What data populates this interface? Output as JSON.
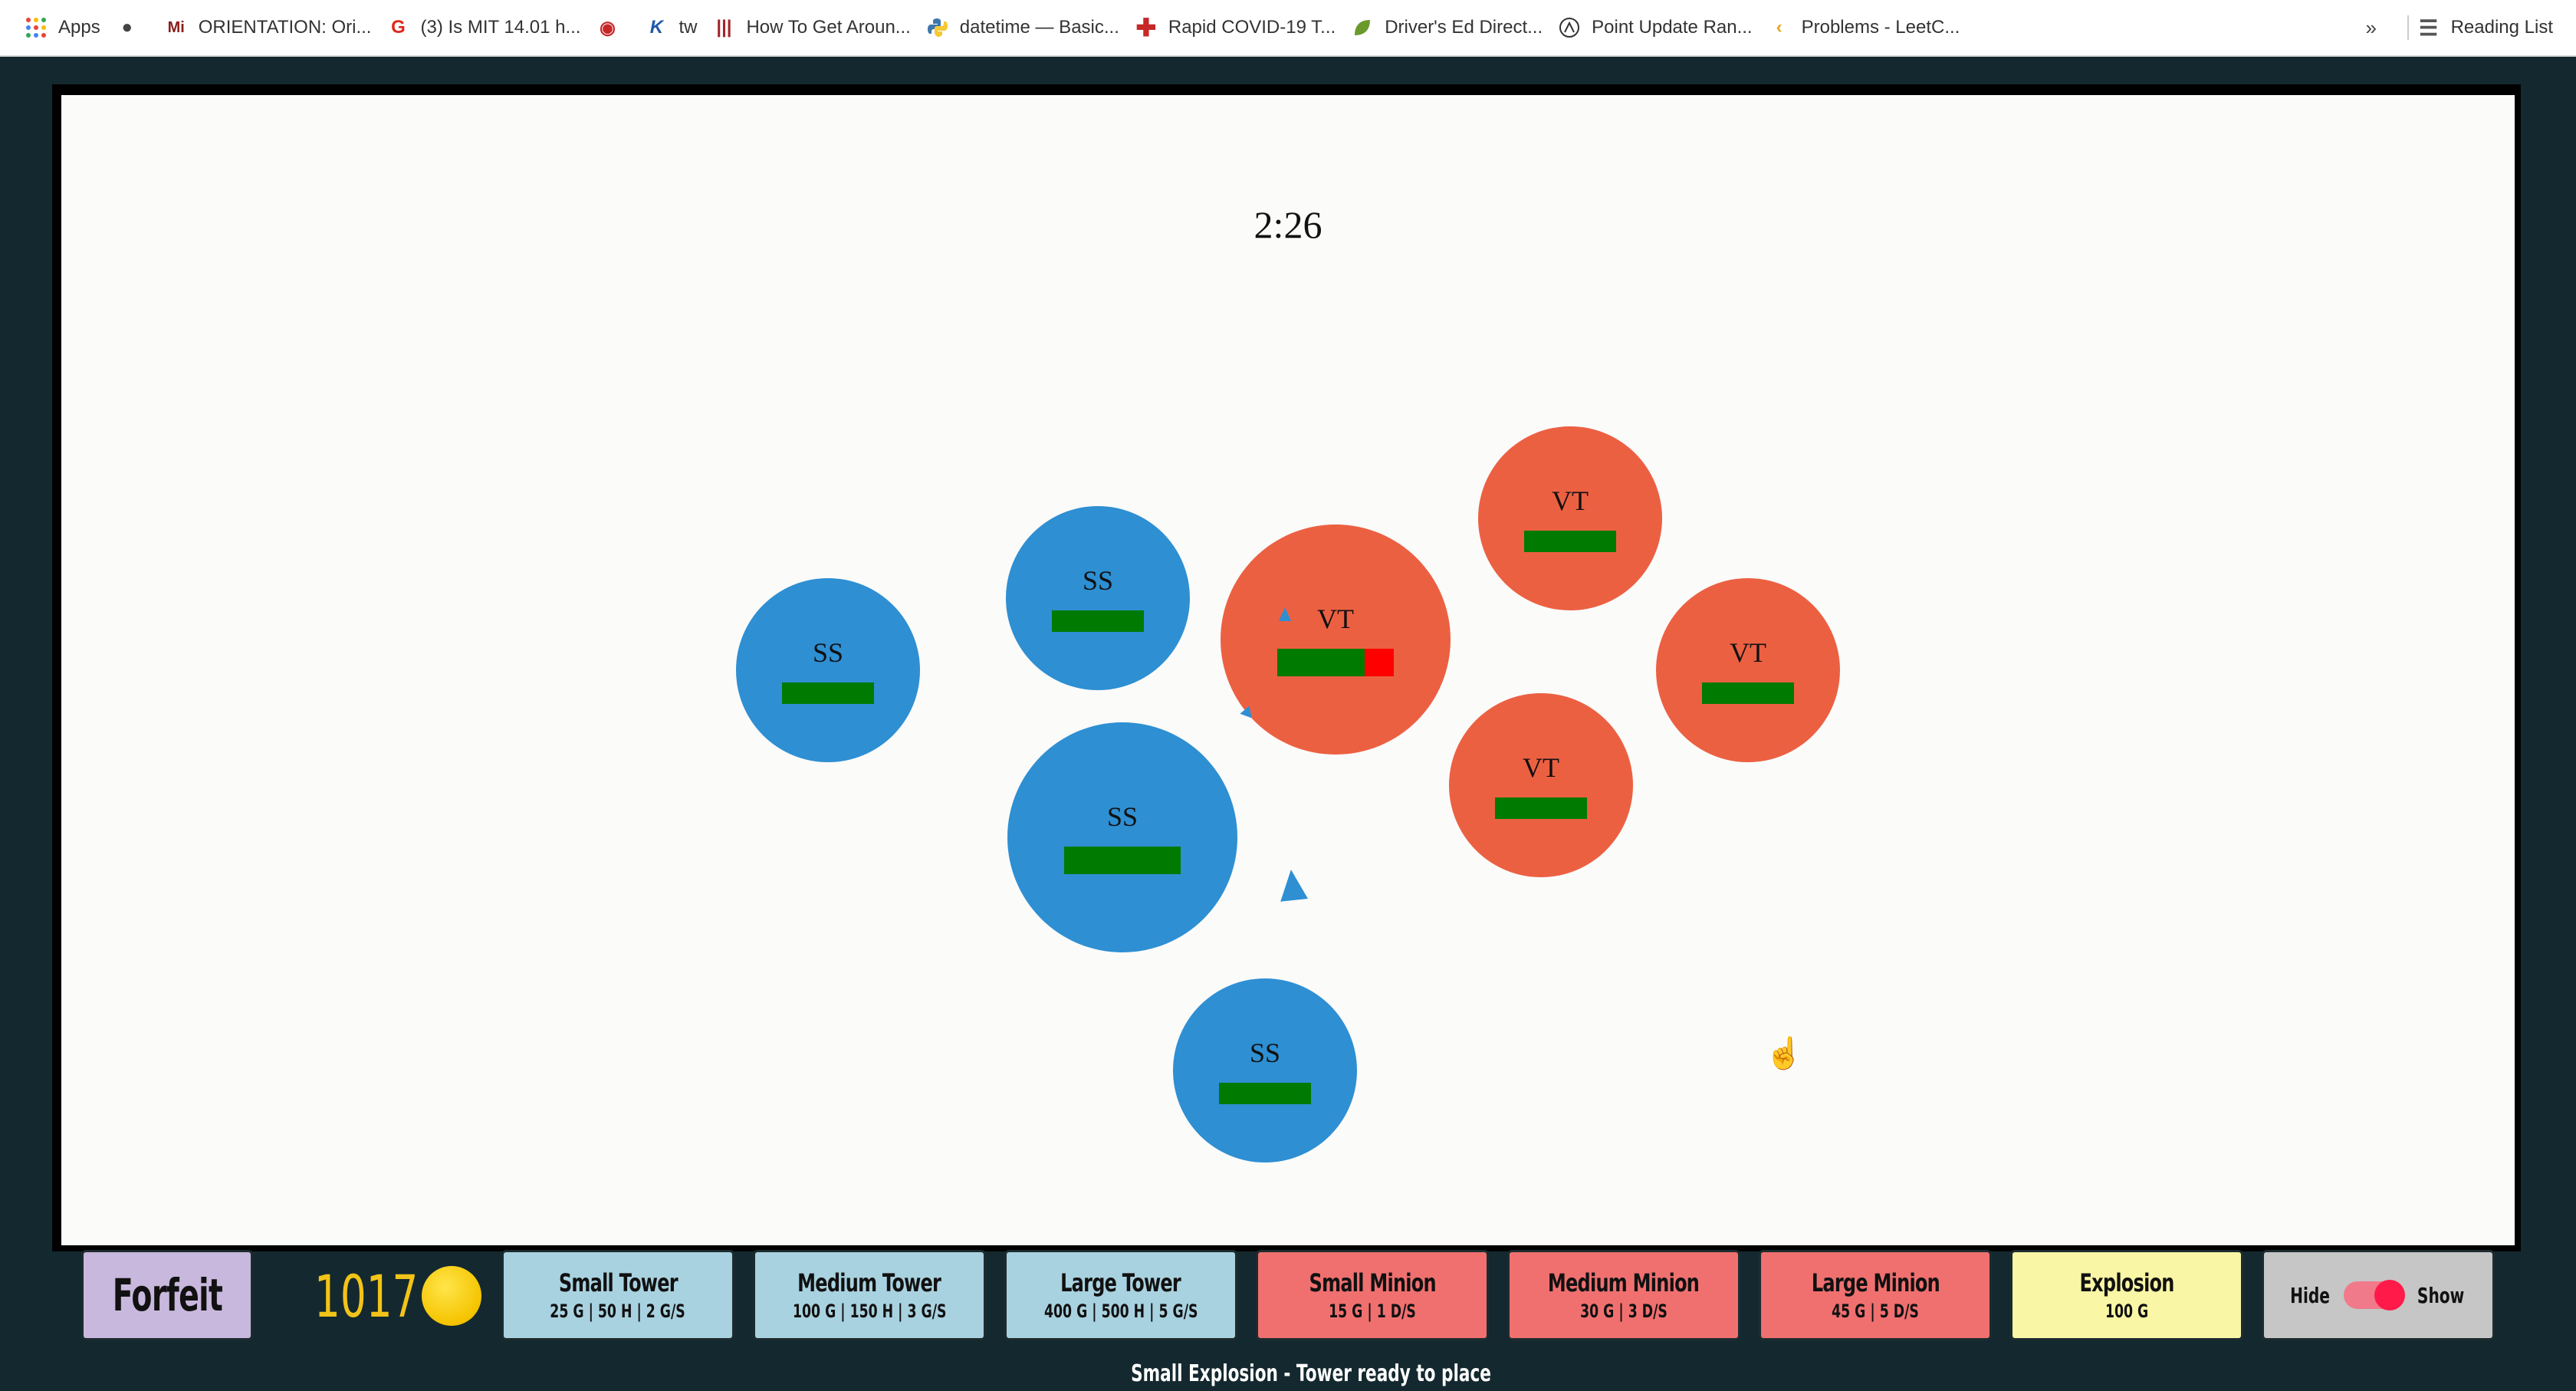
{
  "bookmarks": [
    {
      "label": "Apps",
      "icon": "apps-grid-icon"
    },
    {
      "label": "",
      "icon": "globe-icon"
    },
    {
      "label": "ORIENTATION: Ori...",
      "icon": "mit-logo-icon"
    },
    {
      "label": "(3) Is MIT 14.01 h...",
      "icon": "quora-icon"
    },
    {
      "label": "",
      "icon": "target-icon"
    },
    {
      "label": "tw",
      "icon": "k-logo-icon"
    },
    {
      "label": "How To Get Aroun...",
      "icon": "red-bars-icon"
    },
    {
      "label": "datetime — Basic...",
      "icon": "python-icon"
    },
    {
      "label": "Rapid COVID-19 T...",
      "icon": "medical-cross-icon"
    },
    {
      "label": "Driver's Ed Direct...",
      "icon": "leaf-icon"
    },
    {
      "label": "Point Update Ran...",
      "icon": "peak-icon"
    },
    {
      "label": "Problems - LeetC...",
      "icon": "leetcode-icon"
    }
  ],
  "bookmarks_more": "»",
  "reading_list": "Reading List",
  "game": {
    "timer": "2:26",
    "units": [
      {
        "label": "SS",
        "team": "blue",
        "size": "small",
        "health": 1.0
      },
      {
        "label": "SS",
        "team": "blue",
        "size": "small",
        "health": 1.0
      },
      {
        "label": "SS",
        "team": "blue",
        "size": "medium",
        "health": 1.0
      },
      {
        "label": "SS",
        "team": "blue",
        "size": "small",
        "health": 1.0
      },
      {
        "label": "VT",
        "team": "red",
        "size": "medium",
        "health": 0.75
      },
      {
        "label": "VT",
        "team": "red",
        "size": "small",
        "health": 1.0
      },
      {
        "label": "VT",
        "team": "red",
        "size": "small",
        "health": 1.0
      },
      {
        "label": "VT",
        "team": "red",
        "size": "small",
        "health": 1.0
      }
    ],
    "colors": {
      "blue_team": "#2e8fd3",
      "red_team": "#ec6042",
      "health": "#007a00",
      "damage": "#ff0000"
    }
  },
  "toolbar": {
    "forfeit": "Forfeit",
    "gold": "1017",
    "small_tower": {
      "title": "Small Tower",
      "stats": "25 G | 50 H | 2 G/S"
    },
    "medium_tower": {
      "title": "Medium Tower",
      "stats": "100 G | 150 H | 3 G/S"
    },
    "large_tower": {
      "title": "Large Tower",
      "stats": "400 G | 500 H | 5 G/S"
    },
    "small_minion": {
      "title": "Small Minion",
      "stats": "15 G | 1 D/S"
    },
    "medium_minion": {
      "title": "Medium Minion",
      "stats": "30 G | 3 D/S"
    },
    "large_minion": {
      "title": "Large Minion",
      "stats": "45 G | 5 D/S"
    },
    "explosion": {
      "title": "Explosion",
      "stats": "100 G"
    },
    "toggle": {
      "hide": "Hide",
      "show": "Show",
      "state": "show"
    }
  },
  "status_text": "Small Explosion - Tower ready to place"
}
